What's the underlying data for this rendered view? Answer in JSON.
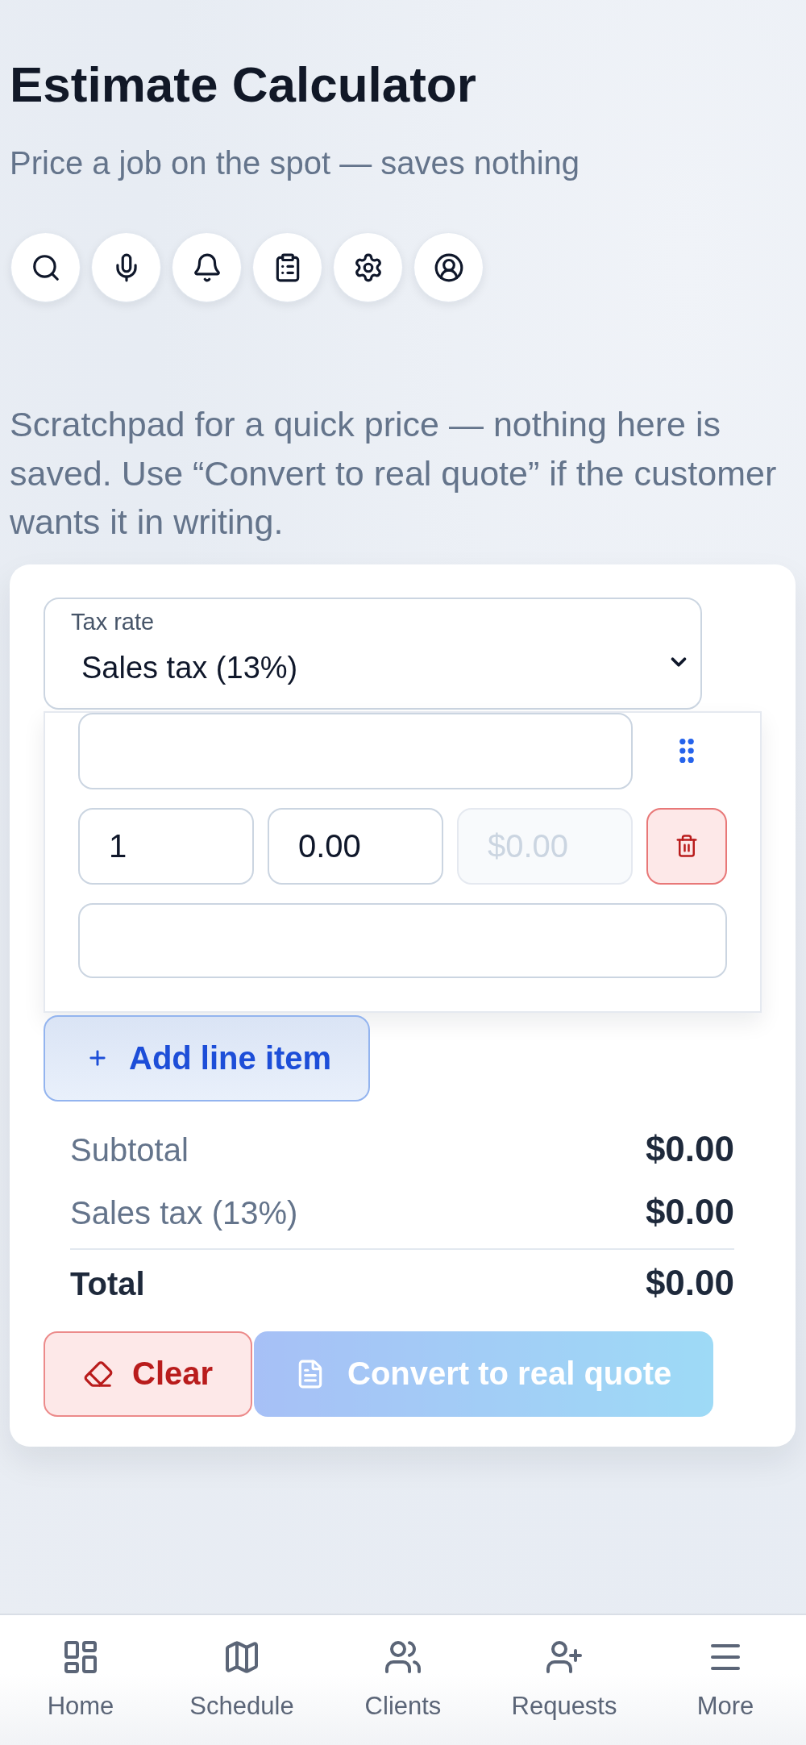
{
  "header": {
    "title": "Estimate Calculator",
    "subtitle": "Price a job on the spot — saves nothing"
  },
  "intro": "Scratchpad for a quick price — nothing here is saved. Use “Convert to real quote” if the customer wants it in writing.",
  "tax_select": {
    "label": "Tax rate",
    "value": "Sales tax (13%)"
  },
  "line_items": [
    {
      "quantity": "1",
      "unit_price": "0.00",
      "amount": {
        "value": "$0.00",
        "disabled": true
      }
    }
  ],
  "add_button": {
    "label": "Add line item"
  },
  "totals": [
    {
      "kind": "line",
      "label": "Subtotal",
      "value": "$0.00"
    },
    {
      "kind": "line",
      "label": "Sales tax (13%)",
      "value": "$0.00"
    },
    {
      "kind": "grand",
      "label": "Total",
      "value": "$0.00"
    }
  ],
  "actions": [
    {
      "kind": "danger",
      "label": "Clear",
      "disabled": false
    },
    {
      "kind": "primary",
      "label": "Convert to real quote",
      "disabled": true
    }
  ],
  "bottom_nav": [
    {
      "label": "Home",
      "selected": false
    },
    {
      "label": "Schedule",
      "selected": false
    },
    {
      "label": "Clients",
      "selected": false
    },
    {
      "label": "Requests",
      "selected": false
    },
    {
      "label": "More",
      "selected": false
    }
  ]
}
